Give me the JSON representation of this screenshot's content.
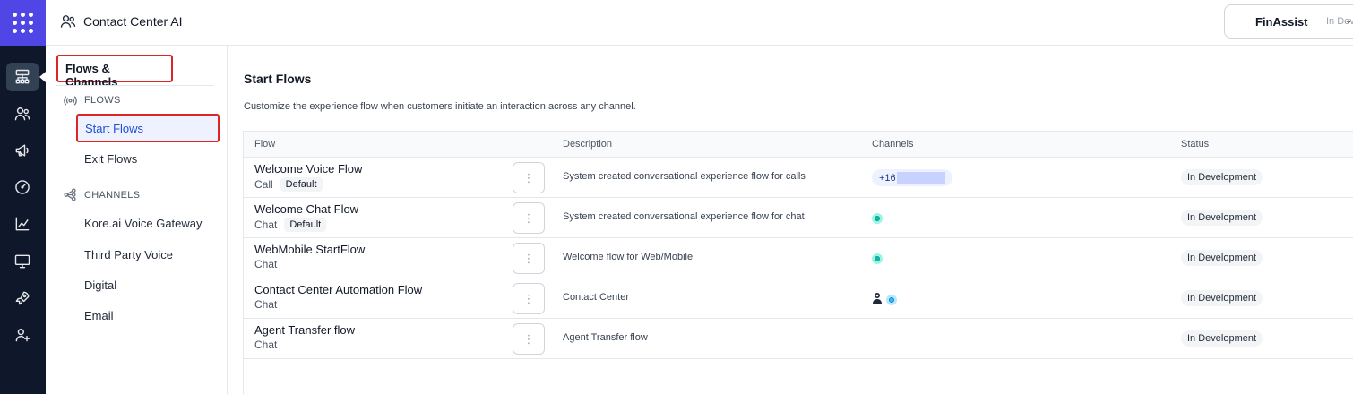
{
  "header": {
    "app_title": "Contact Center AI",
    "bot_name": "FinAssist",
    "bot_env": "In Dev"
  },
  "rail": {
    "icons": [
      "apps-grid-icon",
      "flows-icon",
      "users-icon",
      "campaign-icon",
      "gauge-icon",
      "analytics-icon",
      "monitor-icon",
      "deploy-icon",
      "add-user-icon"
    ]
  },
  "subnav": {
    "section_title": "Flows & Channels",
    "flows_heading": "FLOWS",
    "flows_items": [
      "Start Flows",
      "Exit Flows"
    ],
    "channels_heading": "CHANNELS",
    "channels_items": [
      "Kore.ai Voice Gateway",
      "Third Party Voice",
      "Digital",
      "Email"
    ]
  },
  "main": {
    "title": "Start Flows",
    "description": "Customize the experience flow when customers initiate an interaction across any channel.",
    "columns": [
      "Flow",
      "Description",
      "Channels",
      "Status"
    ],
    "default_badge": "Default",
    "kebab": "⋮",
    "rows": [
      {
        "name": "Welcome Voice Flow",
        "type": "Call",
        "default": true,
        "description": "System created conversational experience flow for calls",
        "channels": "phone",
        "phone_prefix": "+16",
        "status": "In Development"
      },
      {
        "name": "Welcome Chat Flow",
        "type": "Chat",
        "default": true,
        "description": "System created conversational experience flow for chat",
        "channels": "chat",
        "status": "In Development"
      },
      {
        "name": "WebMobile StartFlow",
        "type": "Chat",
        "default": false,
        "description": "Welcome flow for Web/Mobile",
        "channels": "chat",
        "status": "In Development"
      },
      {
        "name": "Contact Center Automation Flow",
        "type": "Chat",
        "default": false,
        "description": "Contact Center",
        "channels": "agent",
        "status": "In Development"
      },
      {
        "name": "Agent Transfer flow",
        "type": "Chat",
        "default": false,
        "description": "Agent Transfer flow",
        "channels": "none",
        "status": "In Development"
      }
    ]
  },
  "colors": {
    "accent": "#4f46e5",
    "rail_bg": "#0f172a",
    "highlight_border": "#dc2626",
    "active_text": "#1d4ed8"
  }
}
